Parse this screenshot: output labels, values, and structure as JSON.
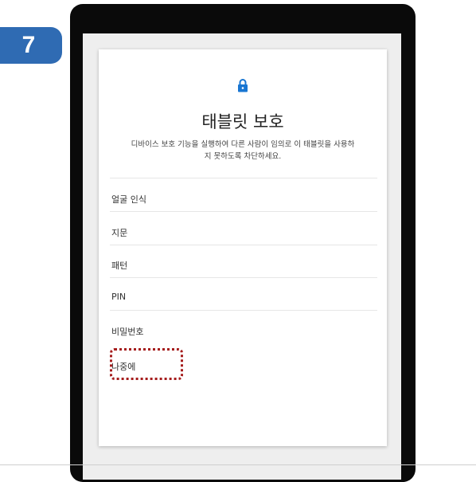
{
  "step_number": "7",
  "dialog": {
    "icon": "lock-icon",
    "title": "태블릿 보호",
    "description": "디바이스 보호 기능을 실행하여 다른 사람이 임의로 이 태블릿을 사용하지 못하도록 차단하세요.",
    "options": [
      "얼굴 인식",
      "지문",
      "패턴",
      "PIN",
      "비밀번호",
      "나중에"
    ]
  },
  "colors": {
    "badge": "#2f6bb3",
    "accent": "#1976d2",
    "highlight": "#a51c1c"
  }
}
